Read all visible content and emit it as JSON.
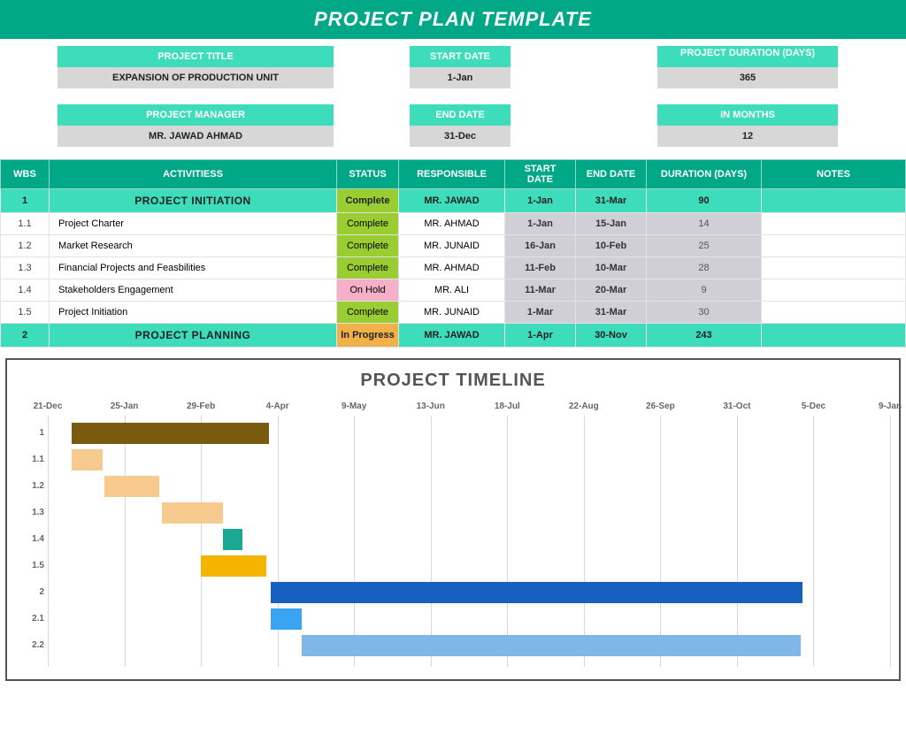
{
  "banner": "PROJECT PLAN TEMPLATE",
  "meta": {
    "project_title_label": "PROJECT TITLE",
    "project_title": "EXPANSION OF PRODUCTION UNIT",
    "start_date_label": "START DATE",
    "start_date": "1-Jan",
    "duration_label": "PROJECT DURATION (DAYS)",
    "duration": "365",
    "manager_label": "PROJECT MANAGER",
    "manager": "MR. JAWAD AHMAD",
    "end_date_label": "END DATE",
    "end_date": "31-Dec",
    "months_label": "IN MONTHS",
    "months": "12"
  },
  "columns": {
    "wbs": "WBS",
    "activities": "ACTIVITIESS",
    "status": "STATUS",
    "responsible": "RESPONSIBLE",
    "start_date_l1": "START",
    "start_date_l2": "DATE",
    "end_date": "END DATE",
    "duration": "DURATION (DAYS)",
    "notes": "NOTES"
  },
  "rows": [
    {
      "wbs": "1",
      "activity": "PROJECT INITIATION",
      "status": "Complete",
      "responsible": "MR. JAWAD",
      "start": "1-Jan",
      "end": "31-Mar",
      "dur": "90",
      "section": true
    },
    {
      "wbs": "1.1",
      "activity": "Project Charter",
      "status": "Complete",
      "responsible": "MR. AHMAD",
      "start": "1-Jan",
      "end": "15-Jan",
      "dur": "14"
    },
    {
      "wbs": "1.2",
      "activity": "Market Research",
      "status": "Complete",
      "responsible": "MR. JUNAID",
      "start": "16-Jan",
      "end": "10-Feb",
      "dur": "25"
    },
    {
      "wbs": "1.3",
      "activity": "Financial Projects and Feasbilities",
      "status": "Complete",
      "responsible": "MR. AHMAD",
      "start": "11-Feb",
      "end": "10-Mar",
      "dur": "28"
    },
    {
      "wbs": "1.4",
      "activity": "Stakeholders Engagement",
      "status": "On Hold",
      "responsible": "MR. ALI",
      "start": "11-Mar",
      "end": "20-Mar",
      "dur": "9"
    },
    {
      "wbs": "1.5",
      "activity": "Project Initiation",
      "status": "Complete",
      "responsible": "MR. JUNAID",
      "start": "1-Mar",
      "end": "31-Mar",
      "dur": "30"
    },
    {
      "wbs": "2",
      "activity": "PROJECT PLANNING",
      "status": "In Progress",
      "responsible": "MR. JAWAD",
      "start": "1-Apr",
      "end": "30-Nov",
      "dur": "243",
      "section": true
    }
  ],
  "timeline_title": "PROJECT TIMELINE",
  "chart_data": {
    "type": "bar",
    "title": "PROJECT TIMELINE",
    "x_ticks": [
      "21-Dec",
      "25-Jan",
      "29-Feb",
      "4-Apr",
      "9-May",
      "13-Jun",
      "18-Jul",
      "22-Aug",
      "26-Sep",
      "31-Oct",
      "5-Dec",
      "9-Jan"
    ],
    "x_range_days": {
      "min": 0,
      "max": 385
    },
    "series": [
      {
        "name": "1",
        "start_day": 11,
        "duration": 90,
        "color": "#7a5a0f"
      },
      {
        "name": "1.1",
        "start_day": 11,
        "duration": 14,
        "color": "#f7ca8f"
      },
      {
        "name": "1.2",
        "start_day": 26,
        "duration": 25,
        "color": "#f7ca8f"
      },
      {
        "name": "1.3",
        "start_day": 52,
        "duration": 28,
        "color": "#f7ca8f"
      },
      {
        "name": "1.4",
        "start_day": 80,
        "duration": 9,
        "color": "#1aa893"
      },
      {
        "name": "1.5",
        "start_day": 70,
        "duration": 30,
        "color": "#f4b400"
      },
      {
        "name": "2",
        "start_day": 102,
        "duration": 243,
        "color": "#1660c0"
      },
      {
        "name": "2.1",
        "start_day": 102,
        "duration": 14,
        "color": "#3aa3f2"
      },
      {
        "name": "2.2",
        "start_day": 116,
        "duration": 228,
        "color": "#7fb7e8"
      }
    ]
  }
}
